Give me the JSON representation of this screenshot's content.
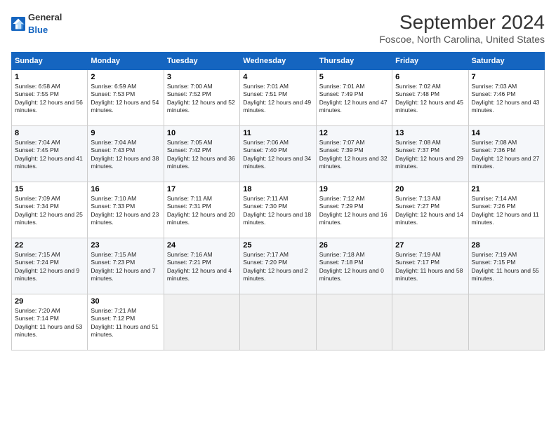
{
  "header": {
    "logo_general": "General",
    "logo_blue": "Blue",
    "title": "September 2024",
    "subtitle": "Foscoe, North Carolina, United States"
  },
  "days_of_week": [
    "Sunday",
    "Monday",
    "Tuesday",
    "Wednesday",
    "Thursday",
    "Friday",
    "Saturday"
  ],
  "weeks": [
    [
      {
        "day": 1,
        "sunrise": "6:58 AM",
        "sunset": "7:55 PM",
        "daylight": "12 hours and 56 minutes."
      },
      {
        "day": 2,
        "sunrise": "6:59 AM",
        "sunset": "7:53 PM",
        "daylight": "12 hours and 54 minutes."
      },
      {
        "day": 3,
        "sunrise": "7:00 AM",
        "sunset": "7:52 PM",
        "daylight": "12 hours and 52 minutes."
      },
      {
        "day": 4,
        "sunrise": "7:01 AM",
        "sunset": "7:51 PM",
        "daylight": "12 hours and 49 minutes."
      },
      {
        "day": 5,
        "sunrise": "7:01 AM",
        "sunset": "7:49 PM",
        "daylight": "12 hours and 47 minutes."
      },
      {
        "day": 6,
        "sunrise": "7:02 AM",
        "sunset": "7:48 PM",
        "daylight": "12 hours and 45 minutes."
      },
      {
        "day": 7,
        "sunrise": "7:03 AM",
        "sunset": "7:46 PM",
        "daylight": "12 hours and 43 minutes."
      }
    ],
    [
      {
        "day": 8,
        "sunrise": "7:04 AM",
        "sunset": "7:45 PM",
        "daylight": "12 hours and 41 minutes."
      },
      {
        "day": 9,
        "sunrise": "7:04 AM",
        "sunset": "7:43 PM",
        "daylight": "12 hours and 38 minutes."
      },
      {
        "day": 10,
        "sunrise": "7:05 AM",
        "sunset": "7:42 PM",
        "daylight": "12 hours and 36 minutes."
      },
      {
        "day": 11,
        "sunrise": "7:06 AM",
        "sunset": "7:40 PM",
        "daylight": "12 hours and 34 minutes."
      },
      {
        "day": 12,
        "sunrise": "7:07 AM",
        "sunset": "7:39 PM",
        "daylight": "12 hours and 32 minutes."
      },
      {
        "day": 13,
        "sunrise": "7:08 AM",
        "sunset": "7:37 PM",
        "daylight": "12 hours and 29 minutes."
      },
      {
        "day": 14,
        "sunrise": "7:08 AM",
        "sunset": "7:36 PM",
        "daylight": "12 hours and 27 minutes."
      }
    ],
    [
      {
        "day": 15,
        "sunrise": "7:09 AM",
        "sunset": "7:34 PM",
        "daylight": "12 hours and 25 minutes."
      },
      {
        "day": 16,
        "sunrise": "7:10 AM",
        "sunset": "7:33 PM",
        "daylight": "12 hours and 23 minutes."
      },
      {
        "day": 17,
        "sunrise": "7:11 AM",
        "sunset": "7:31 PM",
        "daylight": "12 hours and 20 minutes."
      },
      {
        "day": 18,
        "sunrise": "7:11 AM",
        "sunset": "7:30 PM",
        "daylight": "12 hours and 18 minutes."
      },
      {
        "day": 19,
        "sunrise": "7:12 AM",
        "sunset": "7:29 PM",
        "daylight": "12 hours and 16 minutes."
      },
      {
        "day": 20,
        "sunrise": "7:13 AM",
        "sunset": "7:27 PM",
        "daylight": "12 hours and 14 minutes."
      },
      {
        "day": 21,
        "sunrise": "7:14 AM",
        "sunset": "7:26 PM",
        "daylight": "12 hours and 11 minutes."
      }
    ],
    [
      {
        "day": 22,
        "sunrise": "7:15 AM",
        "sunset": "7:24 PM",
        "daylight": "12 hours and 9 minutes."
      },
      {
        "day": 23,
        "sunrise": "7:15 AM",
        "sunset": "7:23 PM",
        "daylight": "12 hours and 7 minutes."
      },
      {
        "day": 24,
        "sunrise": "7:16 AM",
        "sunset": "7:21 PM",
        "daylight": "12 hours and 4 minutes."
      },
      {
        "day": 25,
        "sunrise": "7:17 AM",
        "sunset": "7:20 PM",
        "daylight": "12 hours and 2 minutes."
      },
      {
        "day": 26,
        "sunrise": "7:18 AM",
        "sunset": "7:18 PM",
        "daylight": "12 hours and 0 minutes."
      },
      {
        "day": 27,
        "sunrise": "7:19 AM",
        "sunset": "7:17 PM",
        "daylight": "11 hours and 58 minutes."
      },
      {
        "day": 28,
        "sunrise": "7:19 AM",
        "sunset": "7:15 PM",
        "daylight": "11 hours and 55 minutes."
      }
    ],
    [
      {
        "day": 29,
        "sunrise": "7:20 AM",
        "sunset": "7:14 PM",
        "daylight": "11 hours and 53 minutes."
      },
      {
        "day": 30,
        "sunrise": "7:21 AM",
        "sunset": "7:12 PM",
        "daylight": "11 hours and 51 minutes."
      },
      null,
      null,
      null,
      null,
      null
    ]
  ]
}
